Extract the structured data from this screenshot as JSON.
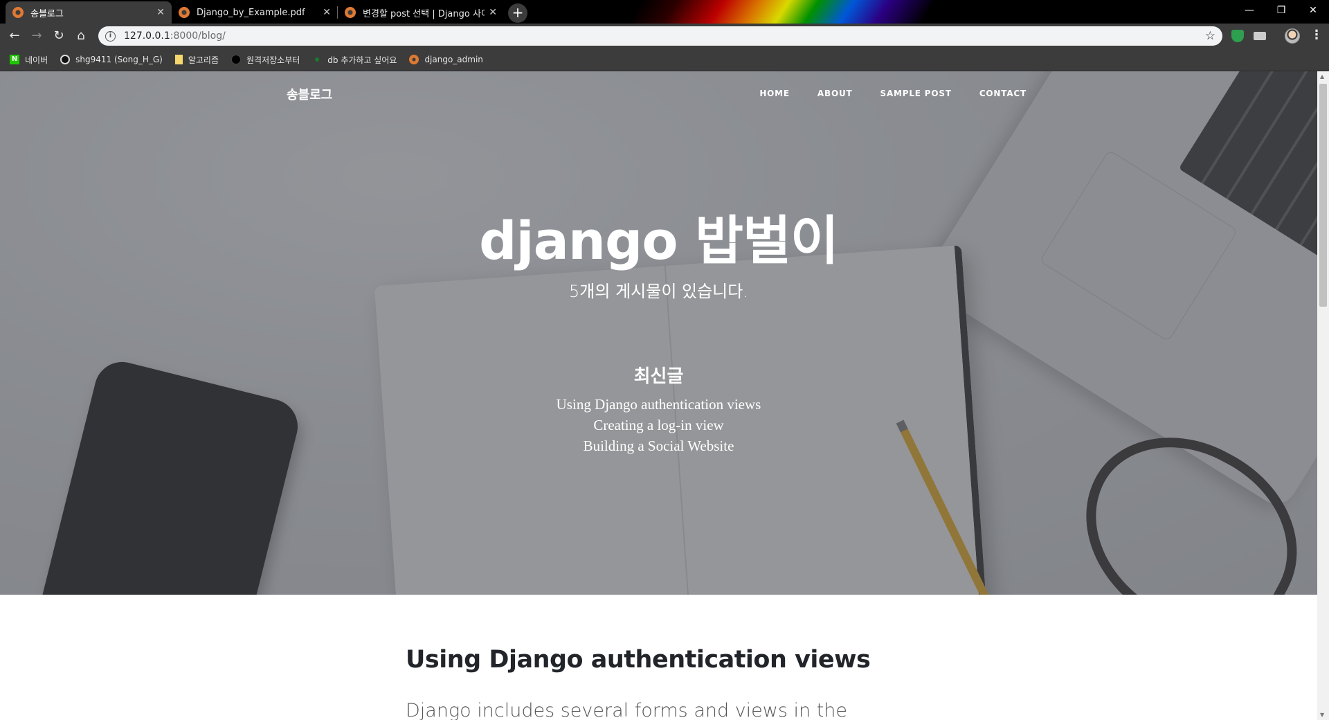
{
  "browser": {
    "tabs": [
      {
        "title": "송블로그",
        "active": true
      },
      {
        "title": "Django_by_Example.pdf",
        "active": false
      },
      {
        "title": "변경할 post 선택 | Django 사이",
        "active": false
      }
    ],
    "new_tab": "+",
    "window_controls": {
      "minimize": "—",
      "restore": "❐",
      "close": "✕"
    },
    "address": {
      "host": "127.0.0.1",
      "rest": ":8000/blog/"
    },
    "bookmarks": [
      {
        "label": "네이버",
        "icon": "naver-icon"
      },
      {
        "label": "shg9411 (Song_H_G)",
        "icon": "github-icon"
      },
      {
        "label": "알고리즘",
        "icon": "folder-icon"
      },
      {
        "label": "원격저장소부터",
        "icon": "circle-icon"
      },
      {
        "label": "db 추가하고 싶어요",
        "icon": "dot-icon"
      },
      {
        "label": "django_admin",
        "icon": "django-icon"
      }
    ]
  },
  "site": {
    "brand": "송블로그",
    "nav": [
      "HOME",
      "ABOUT",
      "SAMPLE POST",
      "CONTACT"
    ],
    "hero": {
      "title": "django 밥벌이",
      "subtitle": "5개의 게시물이 있습니다."
    },
    "recent": {
      "heading": "최신글",
      "items": [
        "Using Django authentication views",
        "Creating a log-in view",
        "Building a Social Website"
      ]
    },
    "post": {
      "title": "Using Django authentication views",
      "excerpt": "Django includes several forms and views in the"
    }
  },
  "colors": {
    "tabbar": "#000000",
    "toolbar": "#3c3c3c",
    "heading_text": "#212529",
    "overlay": "#46484e"
  }
}
